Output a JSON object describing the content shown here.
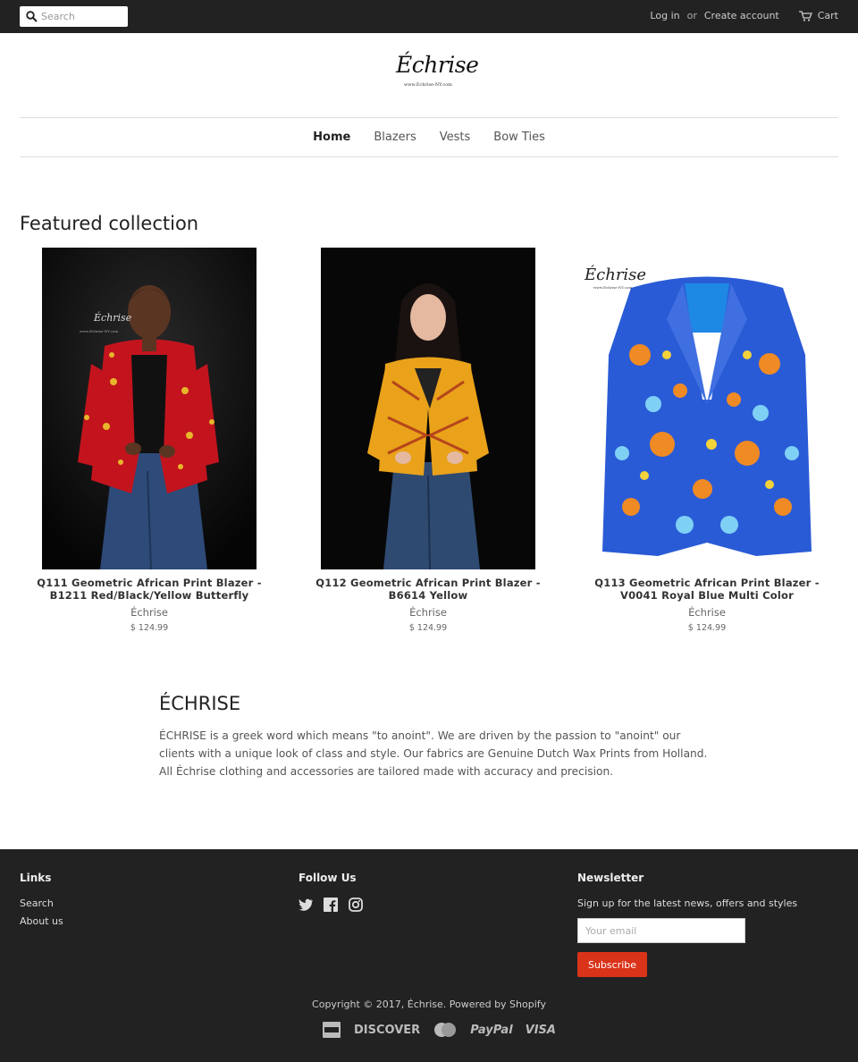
{
  "header": {
    "search_placeholder": "Search",
    "login": "Log in",
    "or": "or",
    "create_account": "Create account",
    "cart": "Cart"
  },
  "logo": {
    "script": "Échrise",
    "sub": "www.Echrise-NY.com"
  },
  "nav": {
    "items": [
      "Home",
      "Blazers",
      "Vests",
      "Bow Ties"
    ],
    "active": "Home"
  },
  "featured": {
    "title": "Featured collection",
    "products": [
      {
        "title": "Q111 Geometric African Print Blazer - B1211 Red/Black/Yellow Butterfly",
        "vendor": "Échrise",
        "price": "$ 124.99"
      },
      {
        "title": "Q112 Geometric African Print Blazer - B6614 Yellow",
        "vendor": "Échrise",
        "price": "$ 124.99"
      },
      {
        "title": "Q113 Geometric African Print Blazer - V0041 Royal Blue Multi Color",
        "vendor": "Échrise",
        "price": "$ 124.99"
      }
    ]
  },
  "about": {
    "title": "ÉCHRISE",
    "line1": "ÉCHRISE is a greek word which means \"to anoint\". We are driven by the passion to \"anoint\" our clients with a unique look of class and style. Our fabrics are Genuine Dutch Wax Prints from Holland.",
    "line2": "All Échrise clothing and accessories are tailored made with accuracy and precision."
  },
  "footer": {
    "links_title": "Links",
    "links": [
      "Search",
      "About us"
    ],
    "follow_title": "Follow Us",
    "newsletter_title": "Newsletter",
    "newsletter_text": "Sign up for the latest news, offers and styles",
    "email_placeholder": "Your email",
    "subscribe": "Subscribe",
    "copyright": "Copyright © 2017, Échrise. Powered by Shopify",
    "payments": [
      "DISCOVER",
      "PayPal",
      "VISA"
    ]
  },
  "colors": {
    "topbar": "#222222",
    "footer": "#222222",
    "subscribe": "#d9331a"
  },
  "icons": [
    "search-icon",
    "cart-icon",
    "twitter-icon",
    "facebook-icon",
    "instagram-icon",
    "amex-icon",
    "mastercard-icon"
  ]
}
